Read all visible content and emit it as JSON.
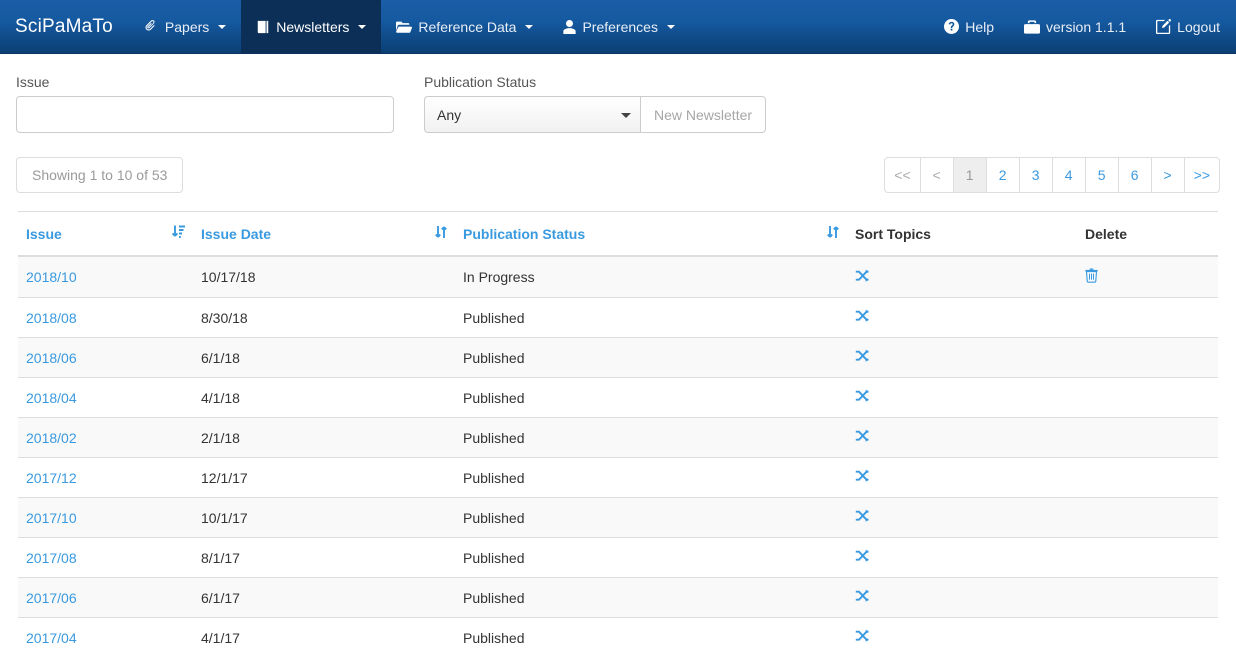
{
  "navbar": {
    "brand": "SciPaMaTo",
    "left_items": [
      {
        "label": "Papers",
        "icon": "paperclip-icon",
        "caret": true,
        "active": false
      },
      {
        "label": "Newsletters",
        "icon": "book-icon",
        "caret": true,
        "active": true
      },
      {
        "label": "Reference Data",
        "icon": "folder-open-icon",
        "caret": true,
        "active": false
      },
      {
        "label": "Preferences",
        "icon": "user-icon",
        "caret": true,
        "active": false
      }
    ],
    "right_items": [
      {
        "label": "Help",
        "icon": "question-circle-icon"
      },
      {
        "label": "version 1.1.1",
        "icon": "briefcase-icon"
      },
      {
        "label": "Logout",
        "icon": "pencil-square-icon"
      }
    ]
  },
  "filters": {
    "issue": {
      "label": "Issue",
      "value": "",
      "placeholder": ""
    },
    "publication_status": {
      "label": "Publication Status",
      "selected": "Any",
      "options": [
        "Any"
      ]
    },
    "new_newsletter_button": "New Newsletter"
  },
  "toolbar": {
    "showing": "Showing 1 to 10 of 53",
    "pagination": [
      {
        "label": "<<",
        "state": "disabled"
      },
      {
        "label": "<",
        "state": "disabled"
      },
      {
        "label": "1",
        "state": "active"
      },
      {
        "label": "2",
        "state": "link"
      },
      {
        "label": "3",
        "state": "link"
      },
      {
        "label": "4",
        "state": "link"
      },
      {
        "label": "5",
        "state": "link"
      },
      {
        "label": "6",
        "state": "link"
      },
      {
        "label": ">",
        "state": "link"
      },
      {
        "label": ">>",
        "state": "link"
      }
    ]
  },
  "table": {
    "columns": [
      {
        "label": "Issue",
        "sortable": true,
        "sort_icon": "sort-amount-desc-icon"
      },
      {
        "label": "Issue Date",
        "sortable": true,
        "sort_icon": "sort-icon"
      },
      {
        "label": "Publication Status",
        "sortable": true,
        "sort_icon": "sort-icon"
      },
      {
        "label": "Sort Topics",
        "sortable": false,
        "sort_icon": ""
      },
      {
        "label": "Delete",
        "sortable": false,
        "sort_icon": ""
      }
    ],
    "rows": [
      {
        "issue": "2018/10",
        "issue_date": "10/17/18",
        "publication_status": "In Progress",
        "sort_topics_icon": "random-icon",
        "delete_icon": "trash-icon"
      },
      {
        "issue": "2018/08",
        "issue_date": "8/30/18",
        "publication_status": "Published",
        "sort_topics_icon": "random-icon",
        "delete_icon": ""
      },
      {
        "issue": "2018/06",
        "issue_date": "6/1/18",
        "publication_status": "Published",
        "sort_topics_icon": "random-icon",
        "delete_icon": ""
      },
      {
        "issue": "2018/04",
        "issue_date": "4/1/18",
        "publication_status": "Published",
        "sort_topics_icon": "random-icon",
        "delete_icon": ""
      },
      {
        "issue": "2018/02",
        "issue_date": "2/1/18",
        "publication_status": "Published",
        "sort_topics_icon": "random-icon",
        "delete_icon": ""
      },
      {
        "issue": "2017/12",
        "issue_date": "12/1/17",
        "publication_status": "Published",
        "sort_topics_icon": "random-icon",
        "delete_icon": ""
      },
      {
        "issue": "2017/10",
        "issue_date": "10/1/17",
        "publication_status": "Published",
        "sort_topics_icon": "random-icon",
        "delete_icon": ""
      },
      {
        "issue": "2017/08",
        "issue_date": "8/1/17",
        "publication_status": "Published",
        "sort_topics_icon": "random-icon",
        "delete_icon": ""
      },
      {
        "issue": "2017/06",
        "issue_date": "6/1/17",
        "publication_status": "Published",
        "sort_topics_icon": "random-icon",
        "delete_icon": ""
      },
      {
        "issue": "2017/04",
        "issue_date": "4/1/17",
        "publication_status": "Published",
        "sort_topics_icon": "random-icon",
        "delete_icon": ""
      }
    ]
  },
  "colors": {
    "navbar_top": "#1b5ea8",
    "navbar_bottom": "#0b3f74",
    "navbar_active": "#0c2f57",
    "link_blue": "#3a9ae0",
    "row_alt": "#f9f9f9",
    "border": "#dddddd"
  }
}
